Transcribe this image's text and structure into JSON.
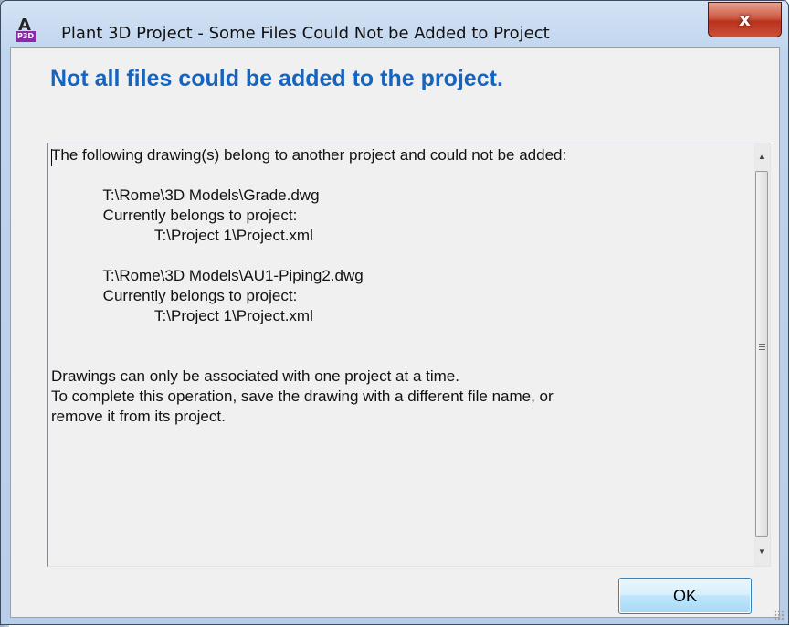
{
  "window": {
    "title": "Plant 3D Project - Some Files Could Not be Added to Project",
    "app_icon_letter": "A",
    "app_icon_badge": "P3D",
    "close_label": "x"
  },
  "main": {
    "heading": "Not all files could be added to the project.",
    "message_lines": [
      "The following drawing(s) belong to another project and could not be added:",
      "",
      "            T:\\Rome\\3D Models\\Grade.dwg",
      "            Currently belongs to project:",
      "                        T:\\Project 1\\Project.xml",
      "",
      "            T:\\Rome\\3D Models\\AU1-Piping2.dwg",
      "            Currently belongs to project:",
      "                        T:\\Project 1\\Project.xml",
      "",
      "",
      "Drawings can only be associated with one project at a time.",
      "To complete this operation, save the drawing with a different file name, or",
      "remove it from its project."
    ],
    "ok_label": "OK"
  },
  "colors": {
    "heading": "#1464c0",
    "close_button": "#c9503a",
    "ok_button": "#bee6fd"
  },
  "icons": {
    "scroll_up": "scroll-up-arrow-icon",
    "scroll_down": "scroll-down-arrow-icon",
    "thumb_grip": "grip-icon"
  }
}
